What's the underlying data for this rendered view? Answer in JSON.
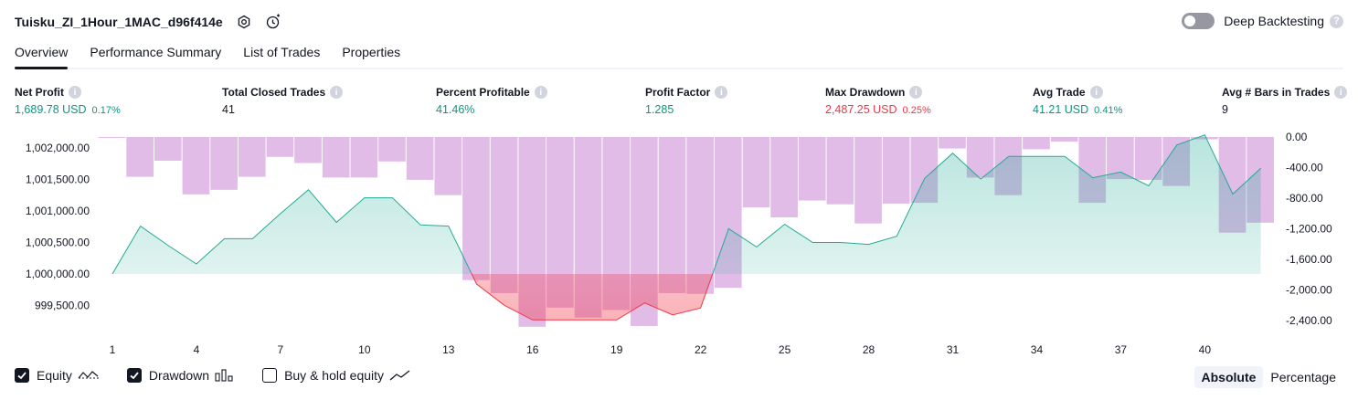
{
  "header": {
    "strategy_name": "Tuisku_ZI_1Hour_1MAC_d96f414e",
    "deep_backtesting_label": "Deep Backtesting",
    "deep_backtesting_enabled": false
  },
  "tabs": [
    {
      "label": "Overview",
      "active": true
    },
    {
      "label": "Performance Summary",
      "active": false
    },
    {
      "label": "List of Trades",
      "active": false
    },
    {
      "label": "Properties",
      "active": false
    }
  ],
  "metrics": [
    {
      "label": "Net Profit",
      "value": "1,689.78 USD",
      "percent": "0.17%",
      "tone": "pos"
    },
    {
      "label": "Total Closed Trades",
      "value": "41",
      "percent": "",
      "tone": "neutral"
    },
    {
      "label": "Percent Profitable",
      "value": "41.46%",
      "percent": "",
      "tone": "pos"
    },
    {
      "label": "Profit Factor",
      "value": "1.285",
      "percent": "",
      "tone": "pos"
    },
    {
      "label": "Max Drawdown",
      "value": "2,487.25 USD",
      "percent": "0.25%",
      "tone": "neg"
    },
    {
      "label": "Avg Trade",
      "value": "41.21 USD",
      "percent": "0.41%",
      "tone": "pos"
    },
    {
      "label": "Avg # Bars in Trades",
      "value": "9",
      "percent": "",
      "tone": "neutral"
    }
  ],
  "chart_data": {
    "type": "line",
    "x_ticks": [
      "1",
      "4",
      "7",
      "10",
      "13",
      "16",
      "19",
      "22",
      "25",
      "28",
      "31",
      "34",
      "37",
      "40"
    ],
    "left_axis_ticks": [
      "1,002,000.00",
      "1,001,500.00",
      "1,001,000.00",
      "1,000,500.00",
      "1,000,000.00",
      "999,500.00"
    ],
    "right_axis_ticks": [
      "0.00",
      "-400.00",
      "-800.00",
      "-1,200.00",
      "-1,600.00",
      "-2,000.00",
      "-2,400.00"
    ],
    "equity_ylim": [
      999200,
      1002200
    ],
    "drawdown_ylim": [
      -2520,
      0
    ],
    "baseline": 1000000,
    "series": [
      {
        "kind": "equity",
        "x": [
          1,
          2,
          3,
          4,
          5,
          6,
          7,
          8,
          9,
          10,
          11,
          12,
          13,
          14,
          15,
          16,
          17,
          18,
          19,
          20,
          21,
          22,
          23,
          24,
          25,
          26,
          27,
          28,
          29,
          30,
          31,
          32,
          33,
          34,
          35,
          36,
          37,
          38,
          39,
          40,
          41,
          42
        ],
        "values": [
          1000000,
          1000760,
          1000450,
          1000160,
          1000560,
          1000560,
          1000960,
          1001340,
          1000820,
          1001210,
          1001210,
          1000780,
          1000760,
          999840,
          999500,
          999270,
          999270,
          999270,
          999270,
          999540,
          999350,
          999460,
          1000720,
          1000430,
          1000790,
          1000500,
          1000500,
          1000470,
          1000600,
          1001520,
          1001920,
          1001510,
          1001870,
          1001870,
          1001870,
          1001530,
          1001620,
          1001400,
          1002050,
          1002210,
          1001270,
          1001680
        ]
      },
      {
        "kind": "drawdown",
        "x": [
          1,
          2,
          3,
          4,
          5,
          6,
          7,
          8,
          9,
          10,
          11,
          12,
          13,
          14,
          15,
          16,
          17,
          18,
          19,
          20,
          21,
          22,
          23,
          24,
          25,
          26,
          27,
          28,
          29,
          30,
          31,
          32,
          33,
          34,
          35,
          36,
          37,
          38,
          39,
          40,
          41,
          42
        ],
        "values": [
          -10,
          -520,
          -310,
          -750,
          -690,
          -520,
          -260,
          -340,
          -530,
          -530,
          -320,
          -560,
          -760,
          -1870,
          -2040,
          -2480,
          -2230,
          -2360,
          -2260,
          -2470,
          -2040,
          -2050,
          -1970,
          -920,
          -1050,
          -830,
          -880,
          -1130,
          -870,
          -860,
          -150,
          -530,
          -760,
          -160,
          -60,
          -860,
          -550,
          -560,
          -640,
          -30,
          -1250,
          -1120
        ]
      }
    ]
  },
  "legend": [
    {
      "label": "Equity",
      "checked": true
    },
    {
      "label": "Drawdown",
      "checked": true
    },
    {
      "label": "Buy & hold equity",
      "checked": false
    }
  ],
  "modes": [
    {
      "label": "Absolute",
      "active": true
    },
    {
      "label": "Percentage",
      "active": false
    }
  ],
  "colors": {
    "positive": "#089981",
    "negative": "#f23645",
    "drawdown_bar": "#ce93d8",
    "equity_line": "#22ab94"
  }
}
